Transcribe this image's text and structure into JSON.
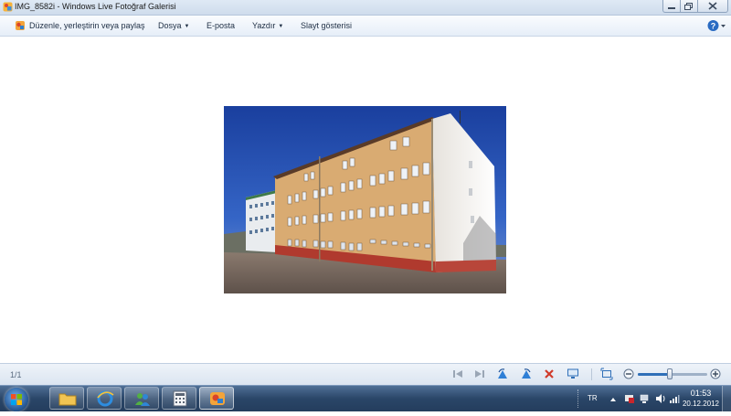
{
  "window": {
    "title": "IMG_8582i - Windows Live Fotoğraf Galerisi"
  },
  "menubar": {
    "items": [
      {
        "label": "Düzenle, yerleştirin veya paylaş",
        "has_arrow": false
      },
      {
        "label": "Dosya",
        "has_arrow": true
      },
      {
        "label": "E-posta",
        "has_arrow": false
      },
      {
        "label": "Yazdır",
        "has_arrow": true
      },
      {
        "label": "Slayt gösterisi",
        "has_arrow": false
      }
    ],
    "help_icon": "help-icon"
  },
  "viewer": {
    "counter": "1/1",
    "zoom_level": 0.45
  },
  "taskbar": {
    "language": "TR",
    "time": "01:53",
    "date": "20.12.2012"
  },
  "colors": {
    "accent": "#1e6fd9",
    "delete": "#d03a2a"
  }
}
